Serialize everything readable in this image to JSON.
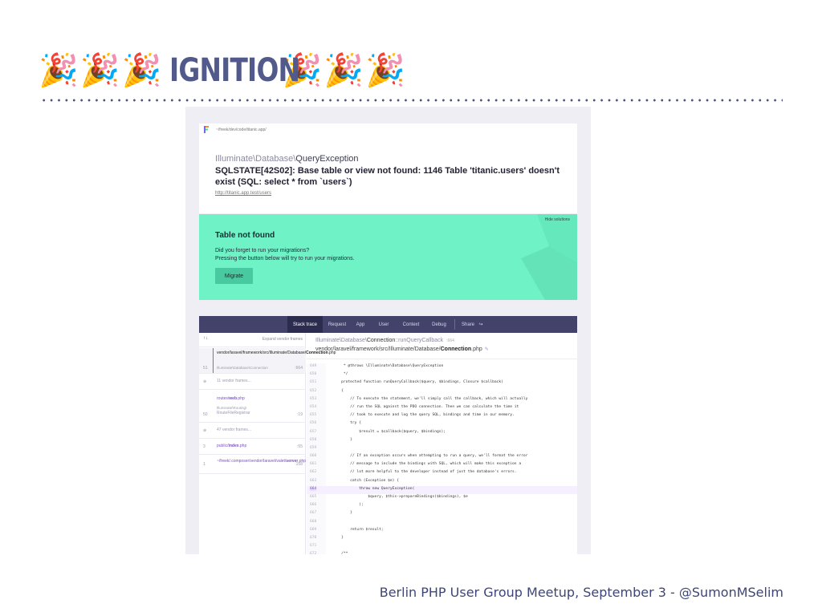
{
  "slide": {
    "title_emoji": "🎉",
    "title": "IGNITION",
    "footer": "Berlin PHP User Group Meetup, September 3 - @SumonMSelim"
  },
  "error_card": {
    "path": "~/freek/dev/code/titanic.app/",
    "exception_namespace": "Illuminate\\Database\\",
    "exception_class": "QueryException",
    "message": "SQLSTATE[42S02]: Base table or view not found: 1146 Table 'titanic.users' doesn't exist (SQL: select * from `users`)",
    "url": "http://titanic.app.test/users"
  },
  "solution": {
    "hide_label": "Hide solutions",
    "title": "Table not found",
    "line1": "Did you forget to run your migrations?",
    "line2": "Pressing the button below will try to run your migrations.",
    "button": "Migrate"
  },
  "tabs": [
    "Stack trace",
    "Request",
    "App",
    "User",
    "Context",
    "Debug",
    "Share"
  ],
  "frames_header": {
    "arrows": "↑↓",
    "expand": "Expand vendor frames"
  },
  "frames": [
    {
      "main": "vendor/laravel/framework/src/Illuminate/Database/",
      "main_bold": "Connection",
      "main_ext": ".php",
      "num": "",
      "sub": "",
      "ln": ""
    },
    {
      "num": "51",
      "main": "Illuminate\\Database\\Connection",
      "ln": ":664"
    },
    {
      "num": "⊕",
      "main": "11 vendor frames..."
    },
    {
      "num": "",
      "main": "routes/",
      "main_bold": "web",
      "main_ext": ".php"
    },
    {
      "num": "50",
      "sub": "Illuminate\\Routing\\",
      "main": "RouteFileRegistrar",
      "ln": ":19"
    },
    {
      "num": "⊕",
      "main": "47 vendor frames..."
    },
    {
      "num": "3",
      "main": "public/",
      "main_bold": "index",
      "main_ext": ".php",
      "ln": ":55"
    },
    {
      "num": "1",
      "main": "~/freek/.composer/vendor/laravel/valet/",
      "main_bold": "server",
      "main_ext": ".php",
      "ln": ":158"
    }
  ],
  "code_header": {
    "namespace": "Illuminate\\Database\\",
    "class": "Connection",
    "method": "::runQueryCallback",
    "line": ":664",
    "file_path": "vendor/laravel/framework/src/Illuminate/Database/",
    "file_name": "Connection",
    "file_ext": ".php",
    "pencil": "✎"
  },
  "code_lines": [
    {
      "n": "649",
      "t": "     * @throws \\Illuminate\\Database\\QueryException"
    },
    {
      "n": "650",
      "t": "     */"
    },
    {
      "n": "651",
      "t": "    protected function runQueryCallback($query, $bindings, Closure $callback)"
    },
    {
      "n": "652",
      "t": "    {"
    },
    {
      "n": "653",
      "t": "        // To execute the statement, we'll simply call the callback, which will actually"
    },
    {
      "n": "654",
      "t": "        // run the SQL against the PDO connection. Then we can calculate the time it"
    },
    {
      "n": "655",
      "t": "        // took to execute and log the query SQL, bindings and time in our memory."
    },
    {
      "n": "656",
      "t": "        try {"
    },
    {
      "n": "657",
      "t": "            $result = $callback($query, $bindings);"
    },
    {
      "n": "658",
      "t": "        }"
    },
    {
      "n": "659",
      "t": ""
    },
    {
      "n": "660",
      "t": "        // If an exception occurs when attempting to run a query, we'll format the error"
    },
    {
      "n": "661",
      "t": "        // message to include the bindings with SQL, which will make this exception a"
    },
    {
      "n": "662",
      "t": "        // lot more helpful to the developer instead of just the database's errors."
    },
    {
      "n": "663",
      "t": "        catch (Exception $e) {"
    },
    {
      "n": "664",
      "t": "            throw new QueryException("
    },
    {
      "n": "665",
      "t": "                $query, $this->prepareBindings($bindings), $e"
    },
    {
      "n": "666",
      "t": "            );"
    },
    {
      "n": "667",
      "t": "        }"
    },
    {
      "n": "668",
      "t": ""
    },
    {
      "n": "669",
      "t": "        return $result;"
    },
    {
      "n": "670",
      "t": "    }"
    },
    {
      "n": "671",
      "t": ""
    },
    {
      "n": "672",
      "t": "    /**"
    }
  ],
  "highlight_line": "664",
  "colors": {
    "solution_bg": "#6ff2c6",
    "tabs_bg": "#42426a",
    "title": "#515a8a"
  }
}
